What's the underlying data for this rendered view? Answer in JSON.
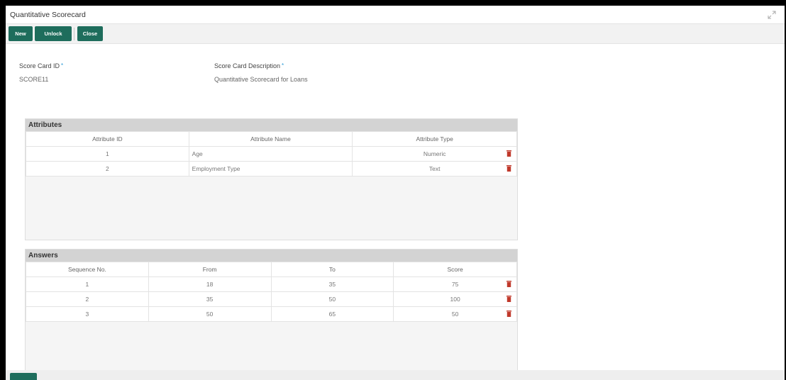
{
  "window": {
    "title": "Quantitative Scorecard"
  },
  "toolbar": {
    "new_label": "New",
    "unlock_label": "Unlock",
    "close_label": "Close"
  },
  "form": {
    "id_label": "Score Card ID",
    "id_value": "SCORE11",
    "desc_label": "Score Card Description",
    "desc_value": "Quantitative Scorecard for Loans",
    "required_marker": "*"
  },
  "attributes": {
    "title": "Attributes",
    "columns": [
      "Attribute ID",
      "Attribute Name",
      "Attribute Type"
    ],
    "rows": [
      {
        "id": "1",
        "name": "Age",
        "type": "Numeric"
      },
      {
        "id": "2",
        "name": "Employment Type",
        "type": "Text"
      }
    ]
  },
  "answers": {
    "title": "Answers",
    "columns": [
      "Sequence No.",
      "From",
      "To",
      "Score"
    ],
    "rows": [
      {
        "seq": "1",
        "from": "18",
        "to": "35",
        "score": "75"
      },
      {
        "seq": "2",
        "from": "35",
        "to": "50",
        "score": "100"
      },
      {
        "seq": "3",
        "from": "50",
        "to": "65",
        "score": "50"
      }
    ]
  },
  "colors": {
    "primary_button": "#1e6d5c",
    "required": "#2a9ad6",
    "delete_icon": "#c0392b"
  }
}
